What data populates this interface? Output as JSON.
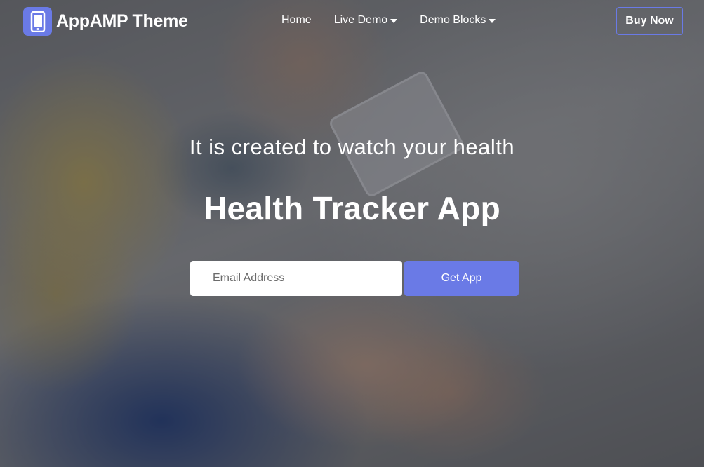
{
  "brand": {
    "name": "AppAMP Theme",
    "icon": "smartphone-icon",
    "accent_color": "#6a7ae6"
  },
  "nav": {
    "items": [
      {
        "label": "Home",
        "has_dropdown": false
      },
      {
        "label": "Live Demo",
        "has_dropdown": true
      },
      {
        "label": "Demo Blocks",
        "has_dropdown": true
      }
    ],
    "buy_label": "Buy Now"
  },
  "hero": {
    "tagline": "It is created to watch your health",
    "title": "Health Tracker App",
    "email_placeholder": "Email Address",
    "cta_label": "Get App"
  }
}
